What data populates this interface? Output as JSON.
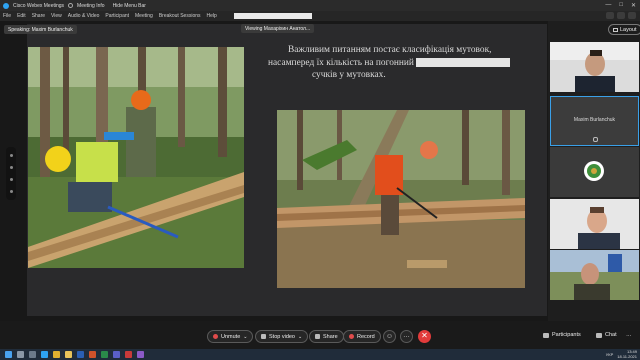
{
  "window": {
    "app_title": "Cisco Webex Meetings",
    "meeting_info": "Meeting Info",
    "hide_menu": "Hide Menu Bar",
    "minimize": "—",
    "maximize": "□",
    "close": "✕"
  },
  "menu": {
    "items": [
      "File",
      "Edit",
      "Share",
      "View",
      "Audio & Video",
      "Participant",
      "Meeting",
      "Breakout Sessions",
      "Help"
    ]
  },
  "stage": {
    "speaking_label": "Speaking: Maxim Burlanchuk",
    "viewing_label": "Viewing Махаріхин Анатол...",
    "layout_label": "Layout"
  },
  "slide": {
    "text_line1": "Важливим питанням постає класифікація мутовок,",
    "text_line2_prefix": "насамперед їх кількість на погонний",
    "text_line3": "сучків  у мутовках."
  },
  "participants": {
    "tile2_name": "Maxim Burlanchuk"
  },
  "controls": {
    "unmute": "Unmute",
    "stop_video": "Stop video",
    "share": "Share",
    "record": "Record",
    "more": "…",
    "end": "✕",
    "participants": "Participants",
    "chat": "Chat"
  },
  "taskbar": {
    "lang": "УКР",
    "time": "13:49",
    "date": "18.11.2021"
  },
  "colors": {
    "accent": "#3aa0e8",
    "end_call": "#e23b3b",
    "background": "#1e1e1e"
  }
}
